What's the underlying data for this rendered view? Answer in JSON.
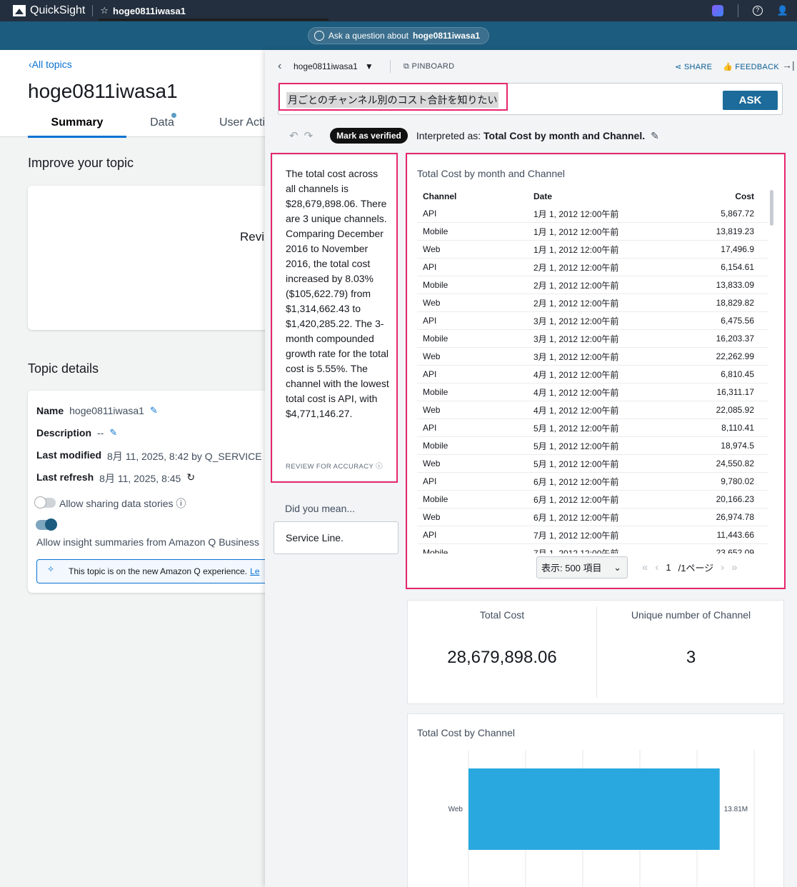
{
  "app": {
    "brand": "QuickSight",
    "doc_title": "hoge0811iwasa1"
  },
  "qbar": {
    "prompt_prefix": "Ask a question about",
    "topic": "hoge0811iwasa1"
  },
  "left": {
    "back_link": "All topics",
    "title": "hoge0811iwasa1",
    "tabs": [
      "Summary",
      "Data",
      "User Acti"
    ],
    "improve_heading": "Improve your topic",
    "improve_card_text": "Revi",
    "details_heading": "Topic details",
    "details": {
      "name_label": "Name",
      "name_value": "hoge0811iwasa1",
      "desc_label": "Description",
      "desc_value": "--",
      "modified_label": "Last modified",
      "modified_value": "8月 11, 2025, 8:42 by Q_SERVICE",
      "refresh_label": "Last refresh",
      "refresh_value": "8月 11, 2025, 8:45"
    },
    "toggle1_label": "Allow sharing data stories",
    "toggle2_label": "Allow insight summaries from Amazon Q Business",
    "info_text": "This topic is on the new Amazon Q experience.",
    "info_link": "Le"
  },
  "panel": {
    "topic_name": "hoge0811iwasa1",
    "pinboard": "PINBOARD",
    "share": "SHARE",
    "feedback": "FEEDBACK",
    "question": "月ごとのチャンネル別のコスト合計を知りたい",
    "ask": "ASK",
    "verify": "Mark as verified",
    "interpreted_prefix": "Interpreted as:",
    "interpreted_value": "Total Cost by month and Channel.",
    "summary_text": "The total cost across all channels is $28,679,898.06. There are 3 unique channels. Comparing December 2016 to November 2016, the total cost increased by 8.03% ($105,622.79) from $1,314,662.43 to $1,420,285.22. The 3-month compounded growth rate for the total cost is 5.55%. The channel with the lowest total cost is API, with $4,771,146.27.",
    "review": "REVIEW FOR ACCURACY",
    "did_you_mean": "Did you mean...",
    "suggestion": "Service Line."
  },
  "table": {
    "title": "Total Cost by month and Channel",
    "columns": [
      "Channel",
      "Date",
      "Cost"
    ],
    "rows": [
      [
        "API",
        "1月 1, 2012 12:00午前",
        "5,867.72"
      ],
      [
        "Mobile",
        "1月 1, 2012 12:00午前",
        "13,819.23"
      ],
      [
        "Web",
        "1月 1, 2012 12:00午前",
        "17,496.9"
      ],
      [
        "API",
        "2月 1, 2012 12:00午前",
        "6,154.61"
      ],
      [
        "Mobile",
        "2月 1, 2012 12:00午前",
        "13,833.09"
      ],
      [
        "Web",
        "2月 1, 2012 12:00午前",
        "18,829.82"
      ],
      [
        "API",
        "3月 1, 2012 12:00午前",
        "6,475.56"
      ],
      [
        "Mobile",
        "3月 1, 2012 12:00午前",
        "16,203.37"
      ],
      [
        "Web",
        "3月 1, 2012 12:00午前",
        "22,262.99"
      ],
      [
        "API",
        "4月 1, 2012 12:00午前",
        "6,810.45"
      ],
      [
        "Mobile",
        "4月 1, 2012 12:00午前",
        "16,311.17"
      ],
      [
        "Web",
        "4月 1, 2012 12:00午前",
        "22,085.92"
      ],
      [
        "API",
        "5月 1, 2012 12:00午前",
        "8,110.41"
      ],
      [
        "Mobile",
        "5月 1, 2012 12:00午前",
        "18,974.5"
      ],
      [
        "Web",
        "5月 1, 2012 12:00午前",
        "24,550.82"
      ],
      [
        "API",
        "6月 1, 2012 12:00午前",
        "9,780.02"
      ],
      [
        "Mobile",
        "6月 1, 2012 12:00午前",
        "20,166.23"
      ],
      [
        "Web",
        "6月 1, 2012 12:00午前",
        "26,974.78"
      ],
      [
        "API",
        "7月 1, 2012 12:00午前",
        "11,443.66"
      ],
      [
        "Mobile",
        "7月 1, 2012 12:00午前",
        "23,652.09"
      ]
    ],
    "page_size": "表示: 500 項目",
    "page_current": "1",
    "page_total": "/1ページ"
  },
  "kpis": [
    {
      "label": "Total Cost",
      "value": "28,679,898.06"
    },
    {
      "label": "Unique number of Channel",
      "value": "3"
    }
  ],
  "chart_data": {
    "type": "bar",
    "orientation": "horizontal",
    "title": "Total Cost by Channel",
    "categories": [
      "Web"
    ],
    "values": [
      13.81
    ],
    "value_labels": [
      "13.81M"
    ],
    "unit": "M",
    "xlim": [
      0,
      17
    ]
  },
  "colors": {
    "accent": "#0972d3",
    "highlight": "#e6266c",
    "bar": "#29a8df",
    "header": "#232f3e",
    "qbar": "#1c5c7e"
  }
}
